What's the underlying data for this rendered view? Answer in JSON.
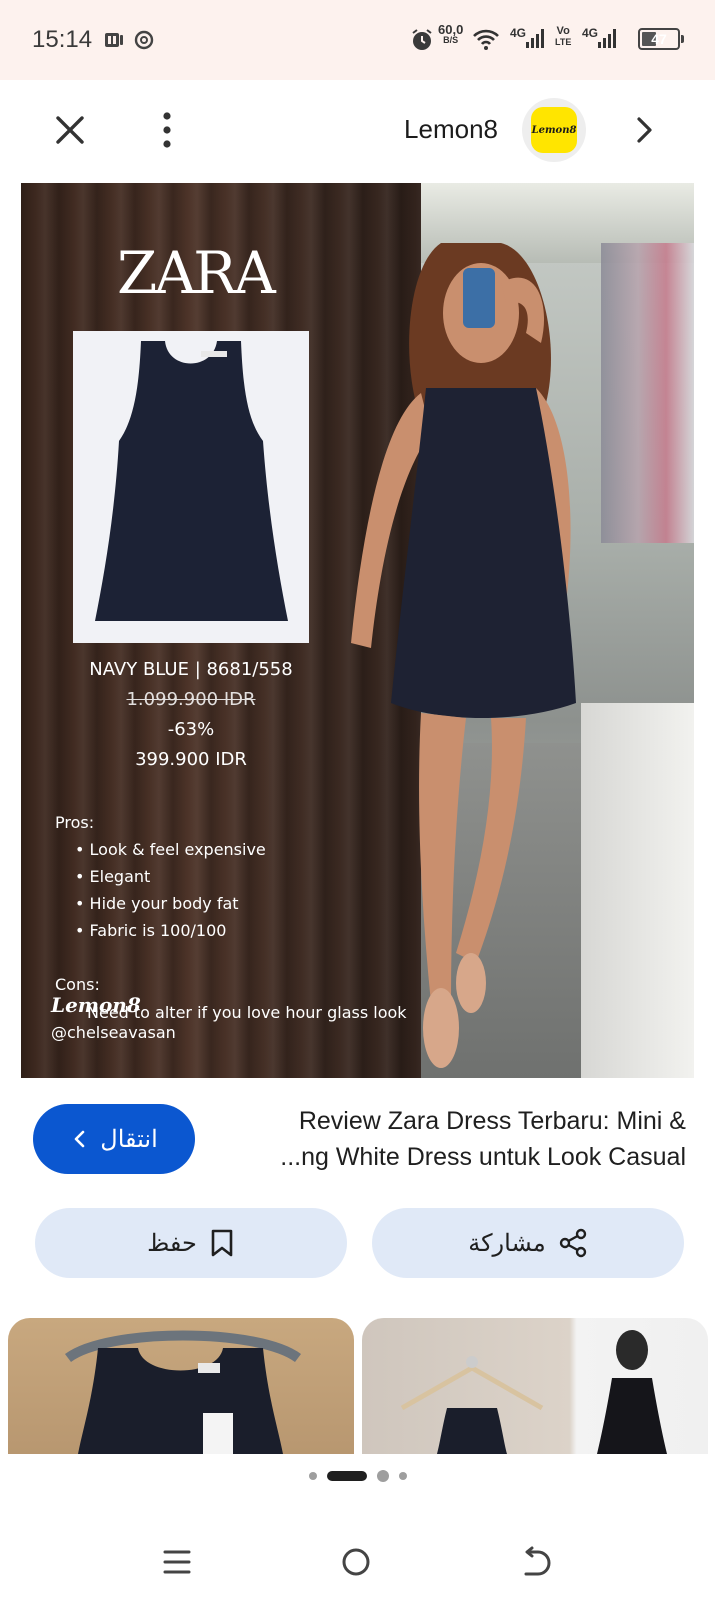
{
  "status_bar": {
    "time": "15:14",
    "net_speed_value": "60,0",
    "net_speed_unit": "B/S",
    "signal1_label": "4G",
    "volte_top": "Vo",
    "volte_bottom": "LTE",
    "signal2_label": "4G",
    "battery": "47",
    "battery_level": 0.47
  },
  "app_bar": {
    "app_name": "Lemon8",
    "app_logo_text": "Lemon8"
  },
  "image_overlay": {
    "brand": "ZARA",
    "color_code": "NAVY BLUE | 8681/558",
    "original_price": "1.099.900 IDR",
    "discount": "-63%",
    "price": "399.900 IDR",
    "pros_title": "Pros:",
    "pros": [
      "Look & feel expensive",
      "Elegant",
      "Hide your body fat",
      "Fabric is 100/100"
    ],
    "cons_title": "Cons:",
    "cons": [
      "Need to alter if you love hour glass look"
    ],
    "watermark": "Lemon8",
    "handle": "@chelseavasan"
  },
  "result": {
    "title_line1": "Review Zara Dress Terbaru: Mini &",
    "title_line2": "...ng White Dress untuk Look Casual",
    "visit_label": "انتقال",
    "save_label": "حفظ",
    "share_label": "مشاركة"
  },
  "colors": {
    "accent": "#0b57d0",
    "pill_bg": "#e0e9f7",
    "status_bg": "#fdf2ee"
  }
}
